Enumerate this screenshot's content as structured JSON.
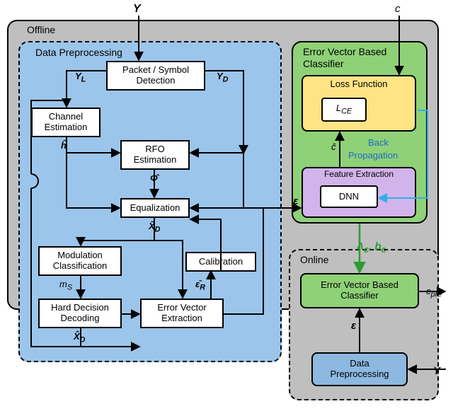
{
  "offline_label": "Offline",
  "online_label": "Online",
  "data_preproc_title": "Data Preprocessing",
  "classifier_title_line1": "Error Vector Based",
  "classifier_title_line2": "Classifier",
  "blocks": {
    "packet_symbol": "Packet / Symbol\nDetection",
    "channel_est": "Channel\nEstimation",
    "rfo_est": "RFO\nEstimation",
    "equalization": "Equalization",
    "mod_class": "Modulation\nClassification",
    "calibration": "Calibration",
    "hard_decision": "Hard Decision\nDecoding",
    "error_vec_ext": "Error Vector\nExtraction",
    "loss_function": "Loss Function",
    "lce": "L",
    "lce_sub": "CE",
    "feature_ext": "Feature Extraction",
    "dnn": "DNN",
    "online_classifier": "Error Vector Based\nClassifier",
    "online_preproc": "Data\nPreprocessing"
  },
  "signals": {
    "Y_top": "Y",
    "c_top": "c",
    "YL": "Y",
    "YL_sub": "L",
    "YD": "Y",
    "YD_sub": "D",
    "h_hat": "ĥ",
    "Phi_hat": "Φ̂",
    "Xbar_D": "X̄",
    "Xbar_D_sub": "D",
    "eps": "ε",
    "eps_R": "ε̄",
    "eps_R_sub": "R",
    "ms": "m",
    "ms_sub": "S",
    "Xhat_D": "X̂",
    "Xhat_D_sub": "D",
    "c_hat": "ĉ",
    "back_prop_line1": "Back",
    "back_prop_line2": "Propagation",
    "Lambda_bc": "Λ",
    "Lambda_sub": "c",
    "bc": "b",
    "bc_sub": "c",
    "c_pre": "c",
    "c_pre_sub": "pre",
    "Y_bottom": "Y",
    "eps_online": "ε"
  }
}
